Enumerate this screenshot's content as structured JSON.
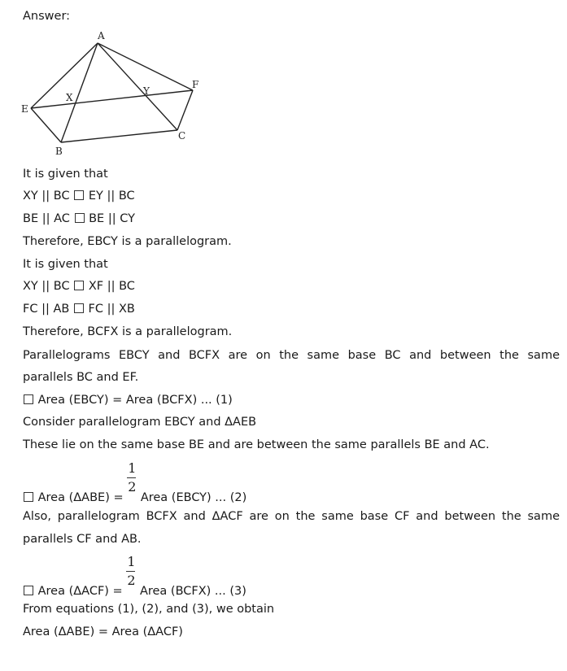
{
  "heading": "Answer:",
  "figure": {
    "points": {
      "A": "A",
      "E": "E",
      "X": "X",
      "Y": "Y",
      "F": "F",
      "B": "B",
      "C": "C"
    }
  },
  "lines": {
    "l1": "It is given that",
    "l2a": "XY || BC",
    "l2b": "EY || BC",
    "l3a": "BE || AC",
    "l3b": "BE || CY",
    "l4": "Therefore, EBCY is a parallelogram.",
    "l5": "It is given that",
    "l6a": "XY || BC",
    "l6b": "XF || BC",
    "l7a": "FC || AB",
    "l7b": "FC || XB",
    "l8": "Therefore, BCFX is a parallelogram.",
    "l9": "Parallelograms EBCY and BCFX are on the same base BC and between the same",
    "l10": "parallels BC and EF.",
    "l11": "Area (EBCY) = Area (BCFX) ... (1)",
    "l12": "Consider parallelogram EBCY and ΔAEB",
    "l13": "These lie on the same base BE and are between the same parallels BE and AC.",
    "l14a": "Area (ΔABE) =",
    "l14num": "1",
    "l14den": "2",
    "l14b": "Area (EBCY) ... (2)",
    "l15": "Also, parallelogram BCFX and ΔACF are on the same base CF and between the same",
    "l16": "parallels CF and AB.",
    "l17a": "Area (ΔACF) =",
    "l17num": "1",
    "l17den": "2",
    "l17b": "Area (BCFX) ... (3)",
    "l18": "From equations (1), (2), and (3), we obtain",
    "l19": "Area (ΔABE) = Area (ΔACF)"
  }
}
